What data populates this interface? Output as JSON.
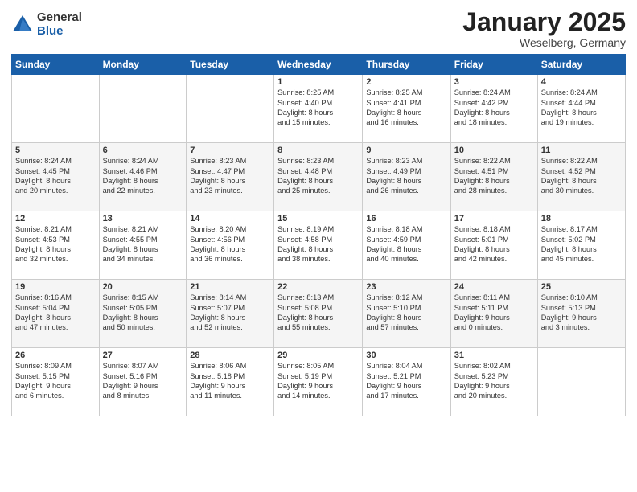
{
  "header": {
    "logo_general": "General",
    "logo_blue": "Blue",
    "month_title": "January 2025",
    "location": "Weselberg, Germany"
  },
  "days_of_week": [
    "Sunday",
    "Monday",
    "Tuesday",
    "Wednesday",
    "Thursday",
    "Friday",
    "Saturday"
  ],
  "weeks": [
    [
      {
        "day": "",
        "info": ""
      },
      {
        "day": "",
        "info": ""
      },
      {
        "day": "",
        "info": ""
      },
      {
        "day": "1",
        "info": "Sunrise: 8:25 AM\nSunset: 4:40 PM\nDaylight: 8 hours\nand 15 minutes."
      },
      {
        "day": "2",
        "info": "Sunrise: 8:25 AM\nSunset: 4:41 PM\nDaylight: 8 hours\nand 16 minutes."
      },
      {
        "day": "3",
        "info": "Sunrise: 8:24 AM\nSunset: 4:42 PM\nDaylight: 8 hours\nand 18 minutes."
      },
      {
        "day": "4",
        "info": "Sunrise: 8:24 AM\nSunset: 4:44 PM\nDaylight: 8 hours\nand 19 minutes."
      }
    ],
    [
      {
        "day": "5",
        "info": "Sunrise: 8:24 AM\nSunset: 4:45 PM\nDaylight: 8 hours\nand 20 minutes."
      },
      {
        "day": "6",
        "info": "Sunrise: 8:24 AM\nSunset: 4:46 PM\nDaylight: 8 hours\nand 22 minutes."
      },
      {
        "day": "7",
        "info": "Sunrise: 8:23 AM\nSunset: 4:47 PM\nDaylight: 8 hours\nand 23 minutes."
      },
      {
        "day": "8",
        "info": "Sunrise: 8:23 AM\nSunset: 4:48 PM\nDaylight: 8 hours\nand 25 minutes."
      },
      {
        "day": "9",
        "info": "Sunrise: 8:23 AM\nSunset: 4:49 PM\nDaylight: 8 hours\nand 26 minutes."
      },
      {
        "day": "10",
        "info": "Sunrise: 8:22 AM\nSunset: 4:51 PM\nDaylight: 8 hours\nand 28 minutes."
      },
      {
        "day": "11",
        "info": "Sunrise: 8:22 AM\nSunset: 4:52 PM\nDaylight: 8 hours\nand 30 minutes."
      }
    ],
    [
      {
        "day": "12",
        "info": "Sunrise: 8:21 AM\nSunset: 4:53 PM\nDaylight: 8 hours\nand 32 minutes."
      },
      {
        "day": "13",
        "info": "Sunrise: 8:21 AM\nSunset: 4:55 PM\nDaylight: 8 hours\nand 34 minutes."
      },
      {
        "day": "14",
        "info": "Sunrise: 8:20 AM\nSunset: 4:56 PM\nDaylight: 8 hours\nand 36 minutes."
      },
      {
        "day": "15",
        "info": "Sunrise: 8:19 AM\nSunset: 4:58 PM\nDaylight: 8 hours\nand 38 minutes."
      },
      {
        "day": "16",
        "info": "Sunrise: 8:18 AM\nSunset: 4:59 PM\nDaylight: 8 hours\nand 40 minutes."
      },
      {
        "day": "17",
        "info": "Sunrise: 8:18 AM\nSunset: 5:01 PM\nDaylight: 8 hours\nand 42 minutes."
      },
      {
        "day": "18",
        "info": "Sunrise: 8:17 AM\nSunset: 5:02 PM\nDaylight: 8 hours\nand 45 minutes."
      }
    ],
    [
      {
        "day": "19",
        "info": "Sunrise: 8:16 AM\nSunset: 5:04 PM\nDaylight: 8 hours\nand 47 minutes."
      },
      {
        "day": "20",
        "info": "Sunrise: 8:15 AM\nSunset: 5:05 PM\nDaylight: 8 hours\nand 50 minutes."
      },
      {
        "day": "21",
        "info": "Sunrise: 8:14 AM\nSunset: 5:07 PM\nDaylight: 8 hours\nand 52 minutes."
      },
      {
        "day": "22",
        "info": "Sunrise: 8:13 AM\nSunset: 5:08 PM\nDaylight: 8 hours\nand 55 minutes."
      },
      {
        "day": "23",
        "info": "Sunrise: 8:12 AM\nSunset: 5:10 PM\nDaylight: 8 hours\nand 57 minutes."
      },
      {
        "day": "24",
        "info": "Sunrise: 8:11 AM\nSunset: 5:11 PM\nDaylight: 9 hours\nand 0 minutes."
      },
      {
        "day": "25",
        "info": "Sunrise: 8:10 AM\nSunset: 5:13 PM\nDaylight: 9 hours\nand 3 minutes."
      }
    ],
    [
      {
        "day": "26",
        "info": "Sunrise: 8:09 AM\nSunset: 5:15 PM\nDaylight: 9 hours\nand 6 minutes."
      },
      {
        "day": "27",
        "info": "Sunrise: 8:07 AM\nSunset: 5:16 PM\nDaylight: 9 hours\nand 8 minutes."
      },
      {
        "day": "28",
        "info": "Sunrise: 8:06 AM\nSunset: 5:18 PM\nDaylight: 9 hours\nand 11 minutes."
      },
      {
        "day": "29",
        "info": "Sunrise: 8:05 AM\nSunset: 5:19 PM\nDaylight: 9 hours\nand 14 minutes."
      },
      {
        "day": "30",
        "info": "Sunrise: 8:04 AM\nSunset: 5:21 PM\nDaylight: 9 hours\nand 17 minutes."
      },
      {
        "day": "31",
        "info": "Sunrise: 8:02 AM\nSunset: 5:23 PM\nDaylight: 9 hours\nand 20 minutes."
      },
      {
        "day": "",
        "info": ""
      }
    ]
  ]
}
